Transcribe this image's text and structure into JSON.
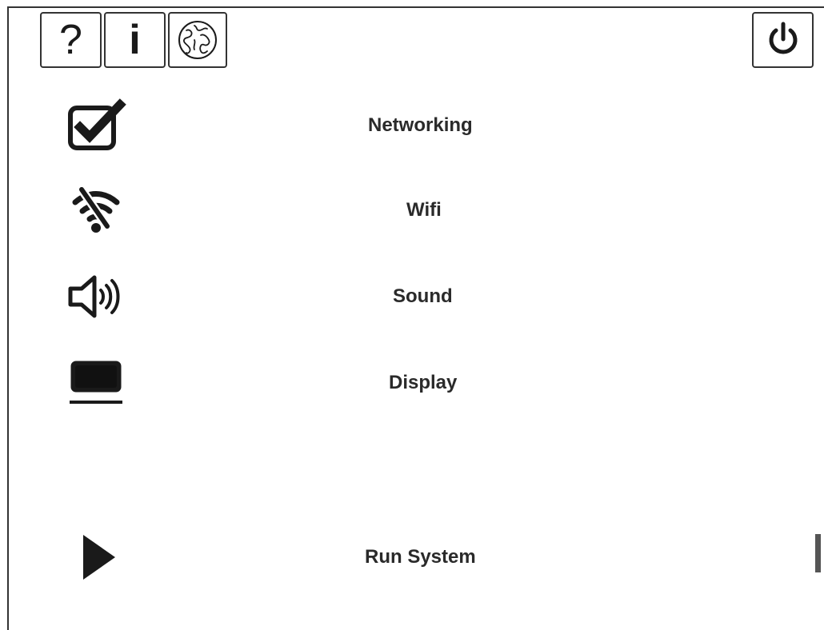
{
  "toolbar": {
    "help_label": "?",
    "info_label": "i",
    "language_icon": "globe-icon",
    "power_icon": "power-icon"
  },
  "menu": {
    "items": [
      {
        "label": "Networking",
        "icon": "checkbox-checked-icon"
      },
      {
        "label": "Wifi",
        "icon": "wifi-off-icon"
      },
      {
        "label": "Sound",
        "icon": "speaker-icon"
      },
      {
        "label": "Display",
        "icon": "monitor-icon"
      },
      {
        "label": "Run System",
        "icon": "play-icon"
      }
    ]
  }
}
